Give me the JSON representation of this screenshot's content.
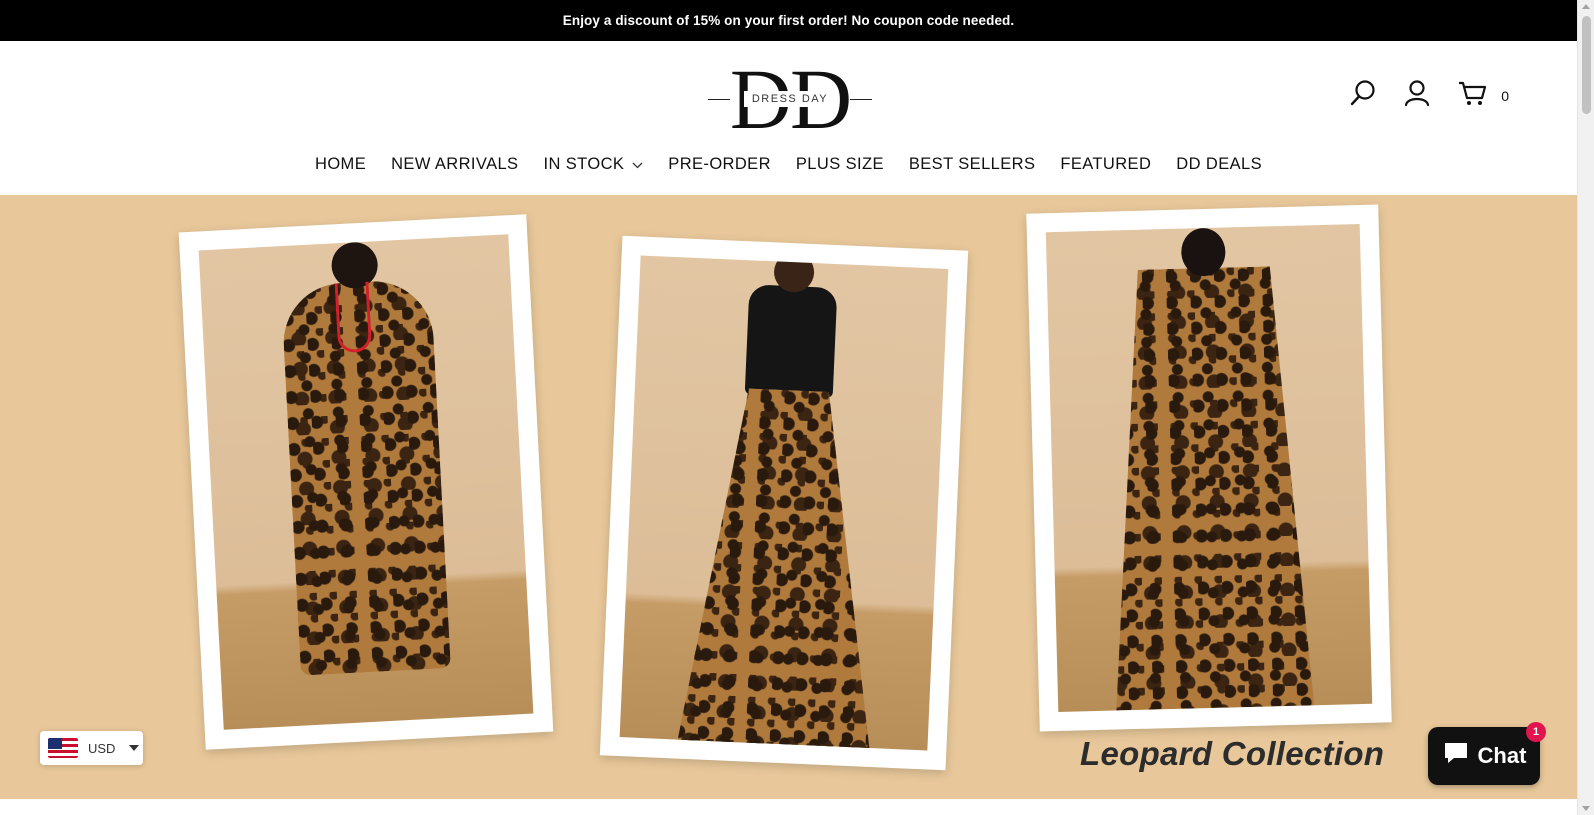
{
  "announcement": {
    "text": "Enjoy a discount of 15% on your first order! No coupon code needed."
  },
  "logo": {
    "letters": "DD",
    "tagline": "DRESS DAY"
  },
  "header": {
    "icons": [
      "search-icon",
      "account-icon",
      "cart-icon"
    ],
    "cart_count": "0"
  },
  "nav": {
    "items": [
      {
        "label": "HOME"
      },
      {
        "label": "NEW ARRIVALS"
      },
      {
        "label": "IN STOCK"
      },
      {
        "label": "PRE-ORDER"
      },
      {
        "label": "PLUS SIZE"
      },
      {
        "label": "BEST SELLERS"
      },
      {
        "label": "FEATURED"
      },
      {
        "label": "DD DEALS"
      }
    ]
  },
  "hero": {
    "title": "Leopard Collection",
    "background_color": "#e8c89a"
  },
  "currency": {
    "code": "USD",
    "flag": "us-flag-icon"
  },
  "chat": {
    "label": "Chat",
    "badge": "1"
  }
}
